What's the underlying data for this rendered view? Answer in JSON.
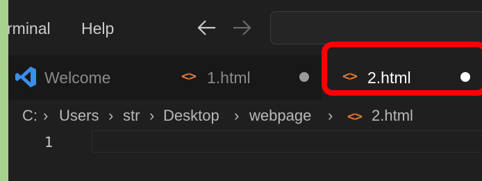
{
  "menubar": {
    "items": [
      {
        "label": "rminal"
      },
      {
        "label": "Help"
      }
    ]
  },
  "tabs": [
    {
      "label": "Welcome",
      "icon": "vscode-icon"
    },
    {
      "label": "1.html",
      "icon": "html-file-icon",
      "dirty": true
    },
    {
      "label": "2.html",
      "icon": "html-file-icon",
      "dirty": true,
      "active": true
    }
  ],
  "breadcrumb": {
    "items": [
      "C:",
      "Users",
      "str",
      "Desktop",
      "webpage",
      "2.html"
    ]
  },
  "editor": {
    "line_number": "1"
  },
  "icons": {
    "html": "<>"
  },
  "colors": {
    "html_icon": "#e37933",
    "highlight": "#ff0000",
    "accent_strip": "#a9d18e",
    "vscode_blue": "#3b8eea"
  }
}
